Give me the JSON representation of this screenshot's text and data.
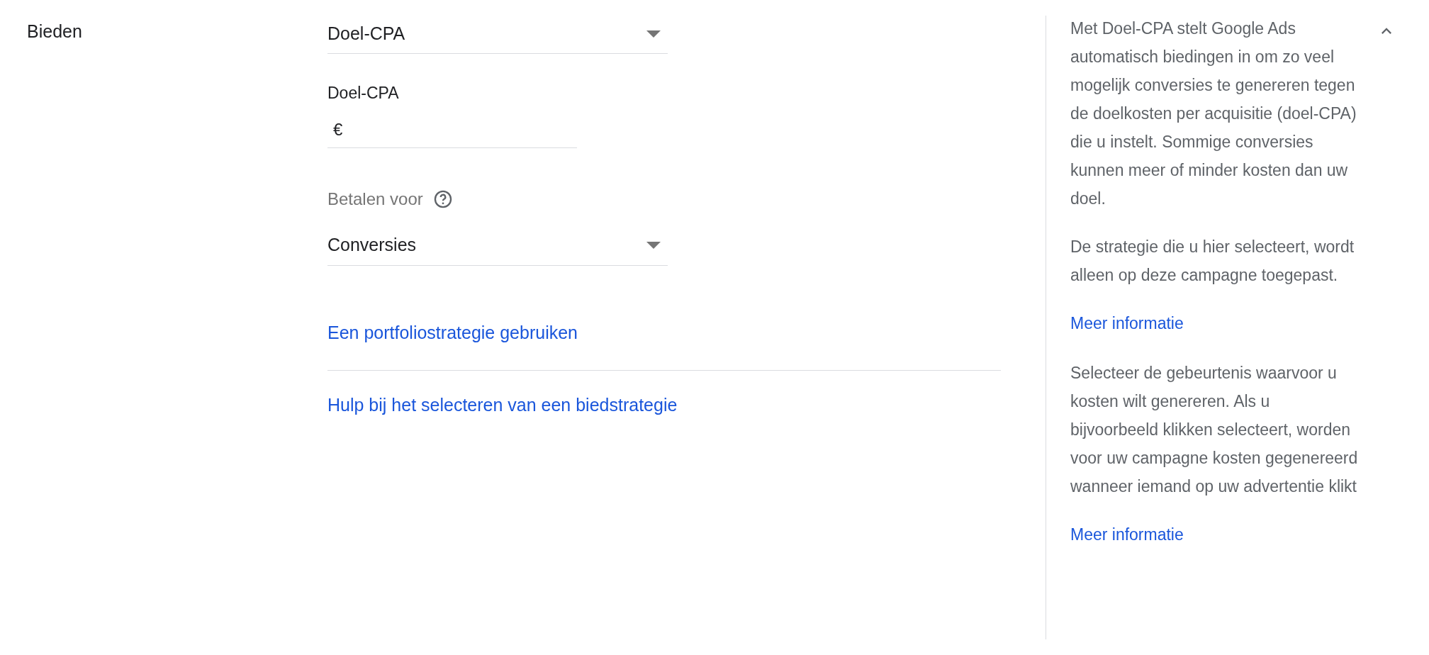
{
  "section": {
    "title": "Bieden",
    "expanded": true
  },
  "bid_strategy": {
    "value": "Doel-CPA"
  },
  "target_cpa": {
    "label": "Doel-CPA",
    "currency": "€"
  },
  "pay_for": {
    "label": "Betalen voor",
    "value": "Conversies"
  },
  "links": [
    "Een portfoliostrategie gebruiken",
    "Hulp bij het selecteren van een biedstrategie"
  ],
  "help": [
    {
      "kind": "text",
      "text": "Met Doel-CPA stelt Google Ads automatisch biedingen in om zo veel mogelijk conversies te genereren tegen de doelkosten per acquisitie (doel-CPA) die u instelt. Sommige conversies kunnen meer of minder kosten dan uw doel."
    },
    {
      "kind": "text",
      "text": "De strategie die u hier selecteert, wordt alleen op deze campagne toegepast."
    },
    {
      "kind": "link",
      "text": "Meer informatie"
    },
    {
      "kind": "text",
      "text": "Selecteer de gebeurtenis waarvoor u kosten wilt genereren. Als u bijvoorbeeld klikken selecteert, worden voor uw campagne kosten gegenereerd wanneer iemand op uw advertentie klikt"
    },
    {
      "kind": "link",
      "text": "Meer informatie"
    }
  ]
}
